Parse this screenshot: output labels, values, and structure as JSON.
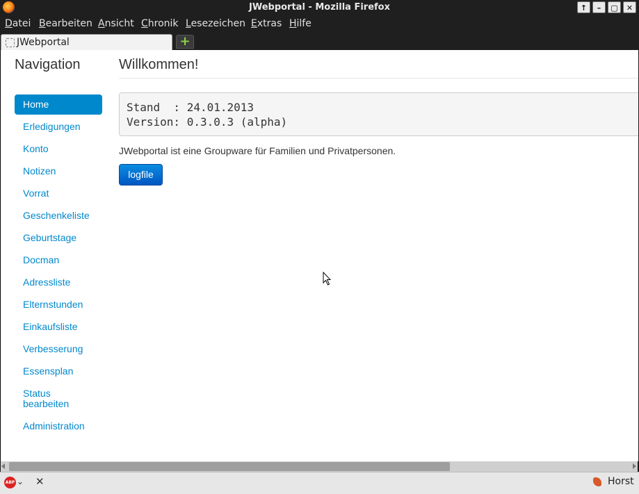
{
  "window": {
    "title": "JWebportal - Mozilla Firefox",
    "controls": [
      "↑",
      "–",
      "▢",
      "✕"
    ]
  },
  "menu": [
    "Datei",
    "Bearbeiten",
    "Ansicht",
    "Chronik",
    "Lesezeichen",
    "Extras",
    "Hilfe"
  ],
  "tab": {
    "label": "JWebportal",
    "new_tab": "+"
  },
  "nav": {
    "header": "Navigation",
    "items": [
      {
        "label": "Home",
        "active": true
      },
      {
        "label": "Erledigungen"
      },
      {
        "label": "Konto"
      },
      {
        "label": "Notizen"
      },
      {
        "label": "Vorrat"
      },
      {
        "label": "Geschenkeliste"
      },
      {
        "label": "Geburtstage"
      },
      {
        "label": "Docman"
      },
      {
        "label": "Adressliste"
      },
      {
        "label": "Elternstunden"
      },
      {
        "label": "Einkaufsliste"
      },
      {
        "label": "Verbesserung"
      },
      {
        "label": "Essensplan"
      },
      {
        "label": "Status bearbeiten"
      },
      {
        "label": "Administration"
      }
    ]
  },
  "main": {
    "title": "Willkommen!",
    "info_lines": [
      "Stand  : 24.01.2013",
      "Version: 0.3.0.3 (alpha)"
    ],
    "description": "JWebportal ist eine Groupware für Familien und Privatpersonen.",
    "button": "logfile"
  },
  "statusbar": {
    "abp_icon": "adblock-plus-icon",
    "abp_text": "ABP",
    "close": "✕",
    "user": "Horst"
  },
  "colors": {
    "accent": "#0088cc",
    "chrome": "#1f1f1f"
  }
}
